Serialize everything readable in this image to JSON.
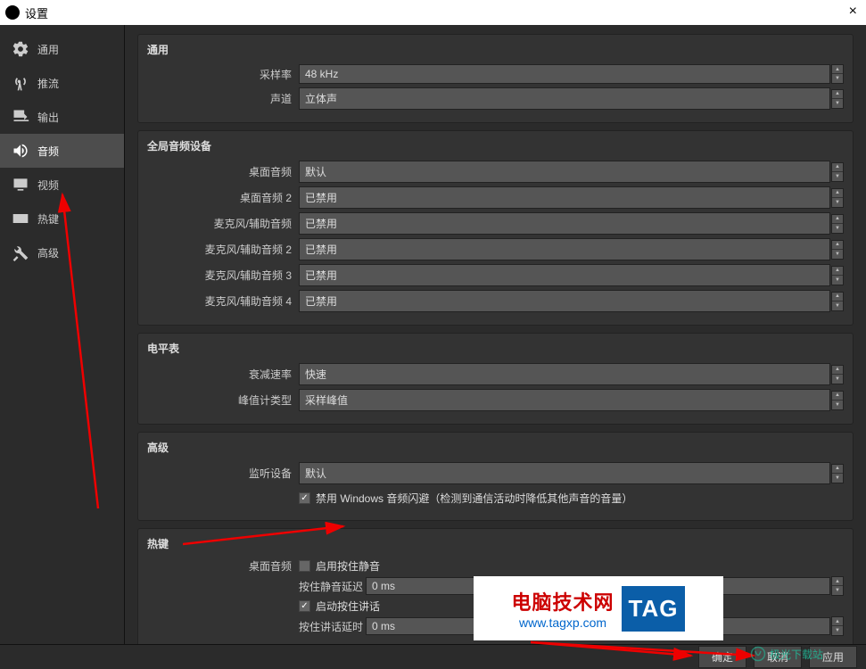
{
  "window": {
    "title": "设置",
    "close_label": "×"
  },
  "sidebar": {
    "items": [
      {
        "label": "通用"
      },
      {
        "label": "推流"
      },
      {
        "label": "输出"
      },
      {
        "label": "音频"
      },
      {
        "label": "视频"
      },
      {
        "label": "热键"
      },
      {
        "label": "高级"
      }
    ]
  },
  "sections": {
    "general": {
      "title": "通用",
      "sample_rate": {
        "label": "采样率",
        "value": "48 kHz"
      },
      "channels": {
        "label": "声道",
        "value": "立体声"
      }
    },
    "devices": {
      "title": "全局音频设备",
      "desktop1": {
        "label": "桌面音频",
        "value": "默认"
      },
      "desktop2": {
        "label": "桌面音频 2",
        "value": "已禁用"
      },
      "mic1": {
        "label": "麦克风/辅助音频",
        "value": "已禁用"
      },
      "mic2": {
        "label": "麦克风/辅助音频 2",
        "value": "已禁用"
      },
      "mic3": {
        "label": "麦克风/辅助音频 3",
        "value": "已禁用"
      },
      "mic4": {
        "label": "麦克风/辅助音频 4",
        "value": "已禁用"
      }
    },
    "meters": {
      "title": "电平表",
      "decay": {
        "label": "衰减速率",
        "value": "快速"
      },
      "peak": {
        "label": "峰值计类型",
        "value": "采样峰值"
      }
    },
    "advanced": {
      "title": "高级",
      "monitor": {
        "label": "监听设备",
        "value": "默认"
      },
      "ducking": {
        "checked": true,
        "label": "禁用 Windows 音频闪避（检测到通信活动时降低其他声音的音量）"
      }
    },
    "hotkeys": {
      "title": "热键",
      "source_label": "桌面音频",
      "mute_enable": {
        "checked": false,
        "label": "启用按住静音"
      },
      "mute_delay": {
        "label": "按住静音延迟",
        "value": "0",
        "unit": "ms"
      },
      "ptt_enable": {
        "checked": true,
        "label": "启动按住讲话"
      },
      "ptt_delay": {
        "label": "按住讲话延时",
        "value": "0",
        "unit": "ms"
      }
    }
  },
  "footer": {
    "ok": "确定",
    "cancel": "取消",
    "apply": "应用"
  },
  "overlay": {
    "site_name": "电脑技术网",
    "site_url": "www.tagxp.com",
    "tag": "TAG",
    "corner": "极光下载站"
  }
}
